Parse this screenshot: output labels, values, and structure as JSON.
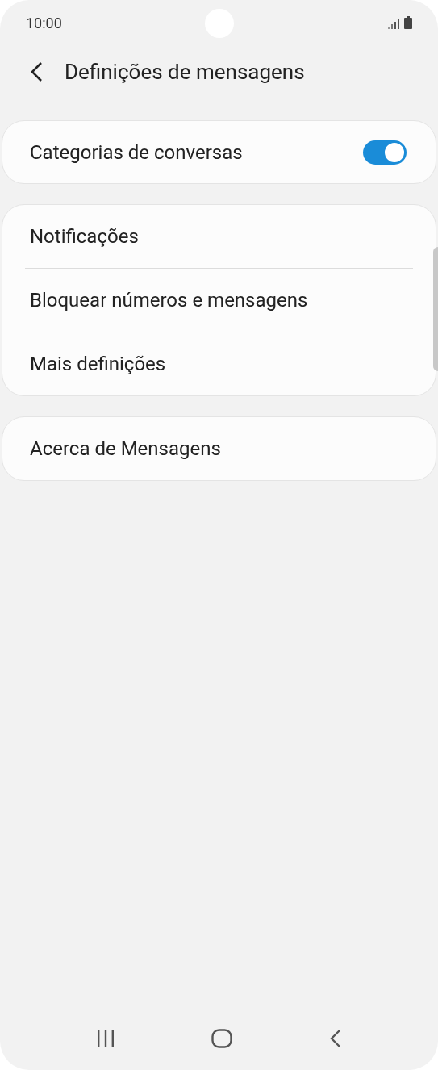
{
  "status_bar": {
    "time": "10:00"
  },
  "header": {
    "title": "Definições de mensagens"
  },
  "groups": [
    {
      "items": [
        {
          "kind": "toggle",
          "label": "Categorias de conversas",
          "on": true
        }
      ]
    },
    {
      "items": [
        {
          "kind": "link",
          "label": "Notificações"
        },
        {
          "kind": "link",
          "label": "Bloquear números e mensagens"
        },
        {
          "kind": "link",
          "label": "Mais definições"
        }
      ]
    },
    {
      "items": [
        {
          "kind": "link",
          "label": "Acerca de Mensagens"
        }
      ]
    }
  ]
}
